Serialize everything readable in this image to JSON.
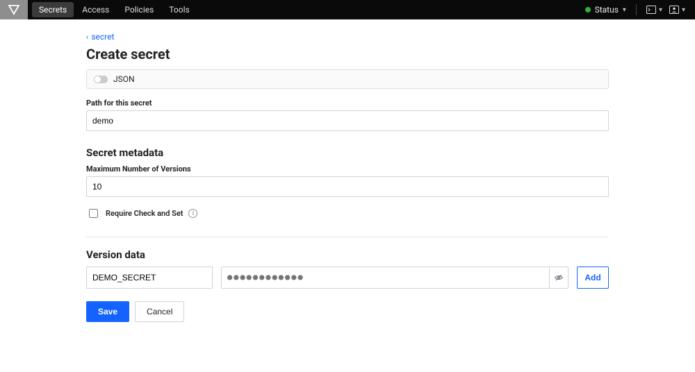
{
  "nav": {
    "items": [
      "Secrets",
      "Access",
      "Policies",
      "Tools"
    ],
    "activeIndex": 0
  },
  "status": {
    "label": "Status"
  },
  "breadcrumb": {
    "link": "secret"
  },
  "page": {
    "title": "Create secret"
  },
  "json_toggle": {
    "label": "JSON",
    "on": false
  },
  "path": {
    "label": "Path for this secret",
    "value": "demo"
  },
  "metadata": {
    "title": "Secret metadata",
    "max_versions_label": "Maximum Number of Versions",
    "max_versions_value": "10",
    "require_cas_label": "Require Check and Set",
    "require_cas_checked": false
  },
  "version_data": {
    "title": "Version data",
    "rows": [
      {
        "key": "DEMO_SECRET",
        "value_masked": "●●●●●●●●●●●●"
      }
    ],
    "add_label": "Add"
  },
  "actions": {
    "save": "Save",
    "cancel": "Cancel"
  }
}
